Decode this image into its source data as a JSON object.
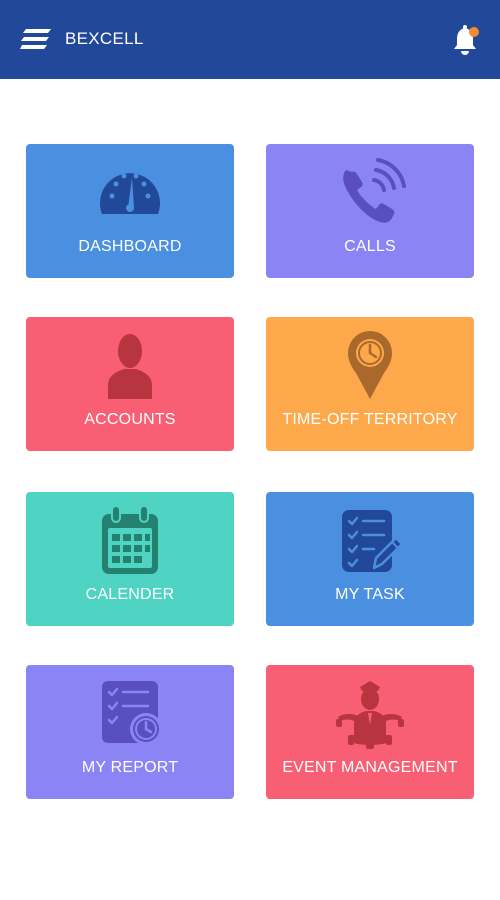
{
  "header": {
    "app_name": "BEXCELL",
    "menu_icon": "hamburger-menu-icon",
    "notification_icon": "bell-icon",
    "notification_dot_color": "#f28b2c",
    "bar_color": "#22489a"
  },
  "tiles": [
    {
      "label": "DASHBOARD",
      "icon": "speedometer-icon",
      "color": "#4a8fe0"
    },
    {
      "label": "CALLS",
      "icon": "phone-call-icon",
      "color": "#8a84f5"
    },
    {
      "label": "ACCOUNTS",
      "icon": "person-icon",
      "color": "#f95f74"
    },
    {
      "label": "TIME-OFF TERRITORY",
      "icon": "location-clock-icon",
      "color": "#fda84a"
    },
    {
      "label": "CALENDER",
      "icon": "calendar-icon",
      "color": "#4fd3c3"
    },
    {
      "label": "MY TASK",
      "icon": "task-checklist-icon",
      "color": "#4a8fe0"
    },
    {
      "label": "MY REPORT",
      "icon": "report-clock-icon",
      "color": "#8a84f5"
    },
    {
      "label": "EVENT MANAGEMENT",
      "icon": "event-manager-icon",
      "color": "#f95f74"
    }
  ]
}
